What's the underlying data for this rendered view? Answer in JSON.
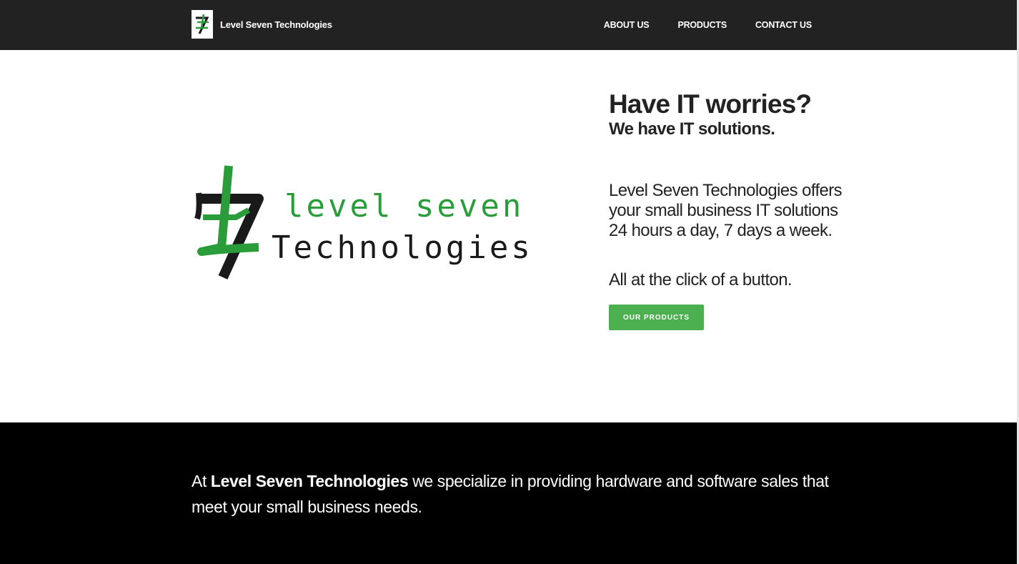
{
  "navbar": {
    "brand_name": "Level Seven Technologies",
    "links": [
      "ABOUT US",
      "PRODUCTS",
      "CONTACT US"
    ]
  },
  "hero": {
    "logo": {
      "line1": "level seven",
      "line2": "Technologies",
      "mark_color_green": "#2a9d3a",
      "mark_color_black": "#1a1a1a"
    },
    "headline": "Have IT worries?",
    "subheadline": "We have IT solutions.",
    "description": "Level Seven Technologies offers your small business IT solutions 24 hours a day, 7 days a week.",
    "tagline": "All at the click of a button.",
    "cta_label": "OUR PRODUCTS"
  },
  "about": {
    "prefix": "At ",
    "company": "Level Seven Technologies",
    "suffix": " we specialize in providing hardware and software sales that meet your small business needs."
  },
  "colors": {
    "navbar_bg": "#222222",
    "accent_green": "#4caf50",
    "about_bg": "#000000"
  }
}
